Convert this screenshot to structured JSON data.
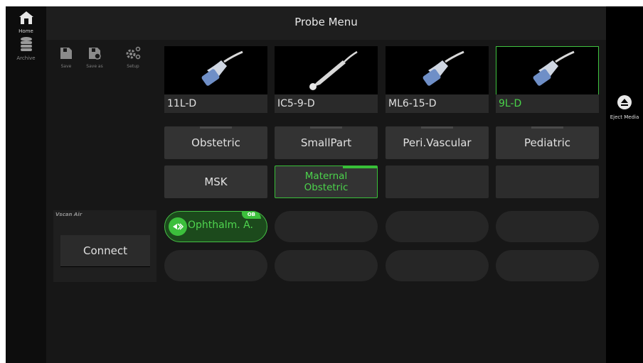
{
  "header": {
    "title": "Probe Menu"
  },
  "sidebar": {
    "home_label": "Home",
    "archive_label": "Archive"
  },
  "toolbar": {
    "save_label": "Save",
    "save_as_label": "Save as",
    "setup_label": "Setup"
  },
  "rightbar": {
    "eject_label": "Eject Media"
  },
  "probes": [
    {
      "label": "11L-D",
      "selected": false
    },
    {
      "label": "IC5-9-D",
      "selected": false
    },
    {
      "label": "ML6-15-D",
      "selected": false
    },
    {
      "label": "9L-D",
      "selected": true
    }
  ],
  "presets": {
    "row1": [
      "Obstetric",
      "SmallPart",
      "Peri.Vascular",
      "Pediatric"
    ],
    "row2": [
      "MSK",
      "Maternal",
      "Obstetric"
    ]
  },
  "user_presets": {
    "active_label": "Ophthalm. A.",
    "active_badge": "OB"
  },
  "vscan": {
    "section_label": "Vscan Air",
    "connect_label": "Connect"
  },
  "colors": {
    "accent": "#3fc23f",
    "panel": "#333333",
    "background": "#171717"
  }
}
